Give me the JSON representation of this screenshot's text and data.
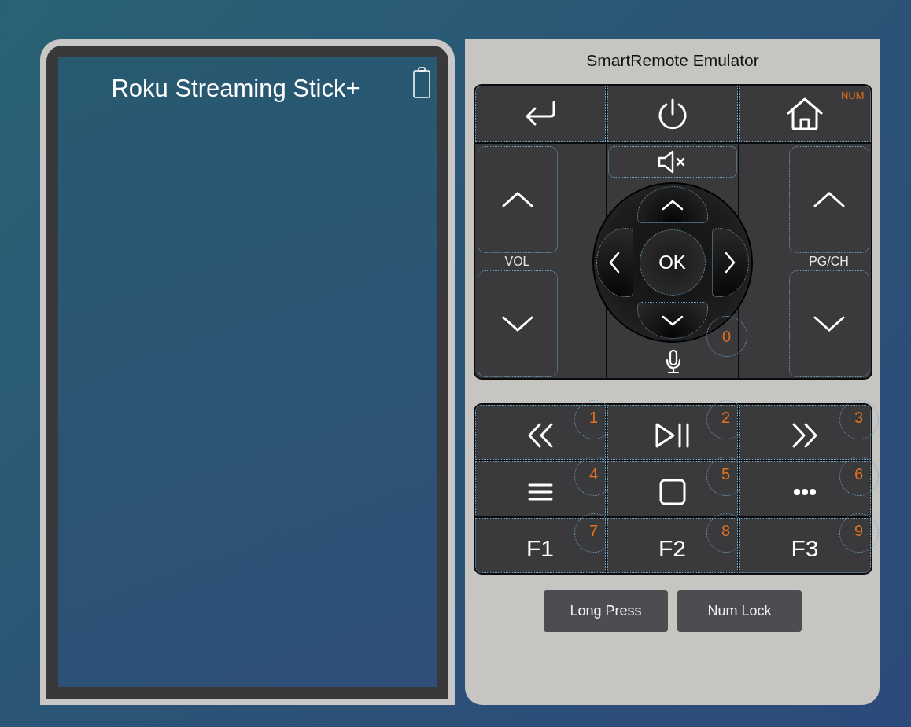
{
  "device": {
    "title": "Roku Streaming Stick+"
  },
  "remote": {
    "title": "SmartRemote Emulator",
    "num_indicator": "NUM",
    "vol_label": "VOL",
    "channel_label": "PG/CH",
    "ok_label": "OK",
    "mic_digit": "0",
    "keys": [
      {
        "kind": "icon",
        "digit": "1"
      },
      {
        "kind": "icon",
        "digit": "2"
      },
      {
        "kind": "icon",
        "digit": "3"
      },
      {
        "kind": "icon",
        "digit": "4"
      },
      {
        "kind": "icon",
        "digit": "5"
      },
      {
        "kind": "icon",
        "digit": "6"
      },
      {
        "kind": "text",
        "label": "F1",
        "digit": "7"
      },
      {
        "kind": "text",
        "label": "F2",
        "digit": "8"
      },
      {
        "kind": "text",
        "label": "F3",
        "digit": "9"
      }
    ],
    "buttons": [
      "Long Press",
      "Num Lock"
    ]
  }
}
